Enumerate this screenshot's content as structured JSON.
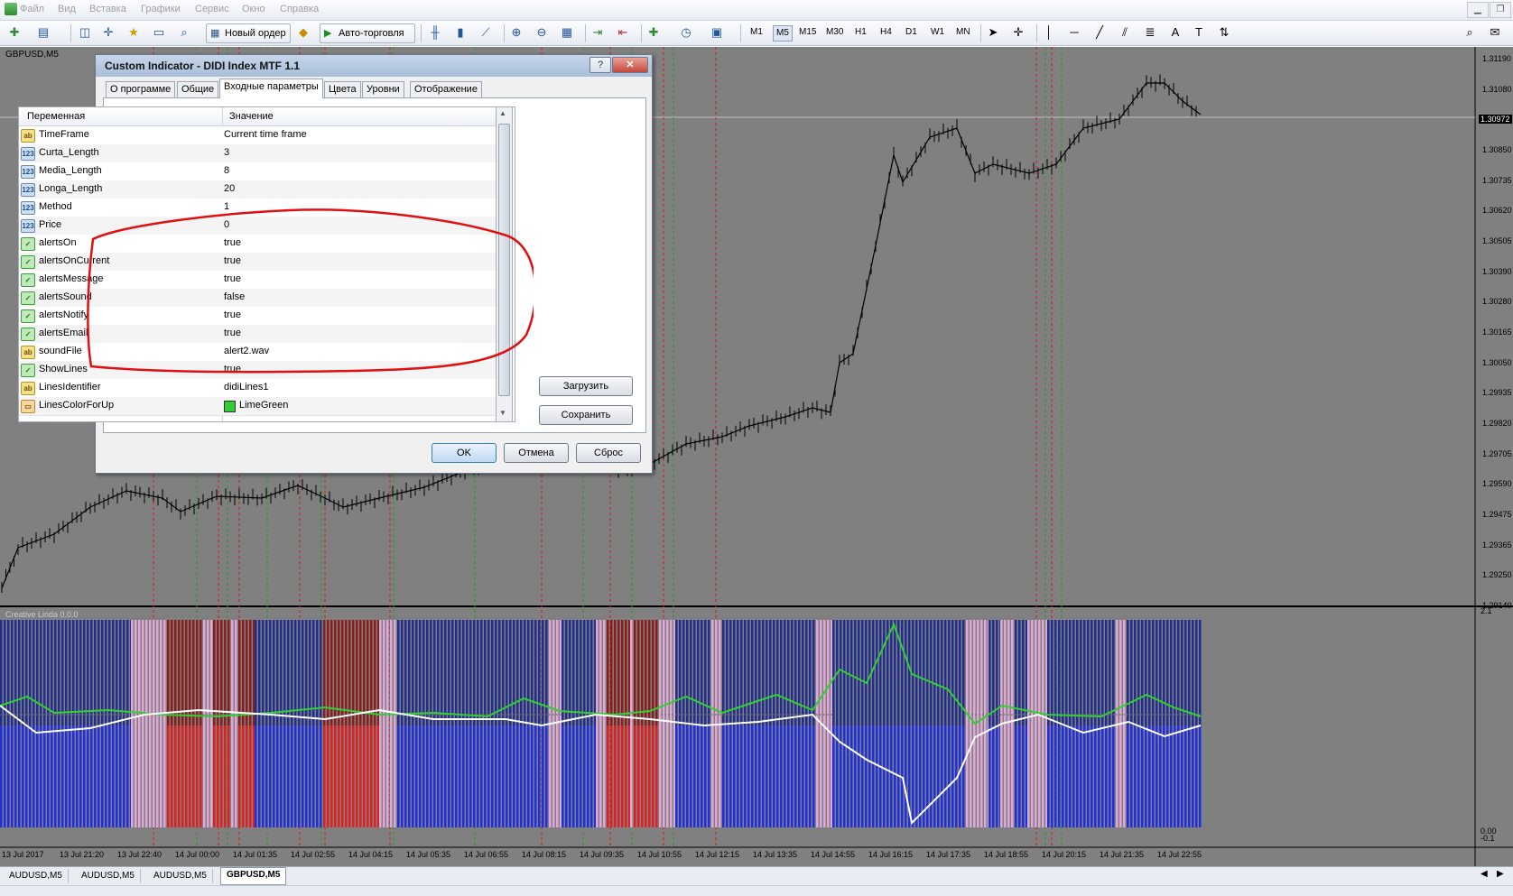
{
  "menu": [
    "Файл",
    "Вид",
    "Вставка",
    "Графики",
    "Сервис",
    "Окно",
    "Справка"
  ],
  "toolbar": {
    "new_order": "Новый ордер",
    "auto_trading": "Авто-торговля",
    "timeframes": [
      "M1",
      "M5",
      "M15",
      "M30",
      "H1",
      "H4",
      "D1",
      "W1",
      "MN"
    ],
    "active_timeframe": "M5"
  },
  "chart": {
    "title": "GBPUSD,M5",
    "subwindow_title": "Creative Linda 0.0.0",
    "price_labels": [
      "1.31190",
      "1.31080",
      "1.30972",
      "1.30850",
      "1.30735",
      "1.30620",
      "1.30505",
      "1.30390",
      "1.30280",
      "1.30165",
      "1.30050",
      "1.29935",
      "1.29820",
      "1.29705",
      "1.29590",
      "1.29475",
      "1.29365",
      "1.29250",
      "1.29140"
    ],
    "current_price": "1.30972",
    "sub_top": "2.1",
    "sub_bottom": "0.00",
    "sub_bottom2": "-0.1",
    "time_labels": [
      "13 Jul 2017",
      "13 Jul 21:20",
      "13 Jul 22:40",
      "14 Jul 00:00",
      "14 Jul 01:35",
      "14 Jul 02:55",
      "14 Jul 04:15",
      "14 Jul 05:35",
      "14 Jul 06:55",
      "14 Jul 08:15",
      "14 Jul 09:35",
      "14 Jul 10:55",
      "14 Jul 12:15",
      "14 Jul 13:35",
      "14 Jul 14:55",
      "14 Jul 16:15",
      "14 Jul 17:35",
      "14 Jul 18:55",
      "14 Jul 20:15",
      "14 Jul 21:35",
      "14 Jul 22:55"
    ]
  },
  "tabs": [
    "AUDUSD,M5",
    "AUDUSD,M5",
    "AUDUSD,M5",
    "GBPUSD,M5"
  ],
  "active_tab": "GBPUSD,M5",
  "dialog": {
    "title": "Custom Indicator - DIDI Index MTF 1.1",
    "help": "?",
    "close": "✕",
    "tabs": [
      "О программе",
      "Общие",
      "Входные параметры",
      "Цвета",
      "Уровни",
      "Отображение"
    ],
    "active_tab": "Входные параметры",
    "col_variable": "Переменная",
    "col_value": "Значение",
    "params": [
      {
        "icon": "ab",
        "name": "TimeFrame",
        "value": "Current time frame"
      },
      {
        "icon": "123",
        "name": "Curta_Length",
        "value": "3"
      },
      {
        "icon": "123",
        "name": "Media_Length",
        "value": "8"
      },
      {
        "icon": "123",
        "name": "Longa_Length",
        "value": "20"
      },
      {
        "icon": "123",
        "name": "Method",
        "value": "1"
      },
      {
        "icon": "123",
        "name": "Price",
        "value": "0"
      },
      {
        "icon": "bool",
        "name": "alertsOn",
        "value": "true"
      },
      {
        "icon": "bool",
        "name": "alertsOnCurrent",
        "value": "true"
      },
      {
        "icon": "bool",
        "name": "alertsMessage",
        "value": "true"
      },
      {
        "icon": "bool",
        "name": "alertsSound",
        "value": "false"
      },
      {
        "icon": "bool",
        "name": "alertsNotify",
        "value": "true"
      },
      {
        "icon": "bool",
        "name": "alertsEmail",
        "value": "true"
      },
      {
        "icon": "ab",
        "name": "soundFile",
        "value": "alert2.wav"
      },
      {
        "icon": "bool",
        "name": "ShowLines",
        "value": "true"
      },
      {
        "icon": "ab",
        "name": "LinesIdentifier",
        "value": "didiLines1"
      },
      {
        "icon": "col",
        "name": "LinesColorForUp",
        "value": "LimeGreen",
        "swatch": "#32cd32"
      }
    ],
    "load": "Загрузить",
    "save": "Сохранить",
    "ok": "OK",
    "cancel": "Отмена",
    "reset": "Сброс"
  }
}
